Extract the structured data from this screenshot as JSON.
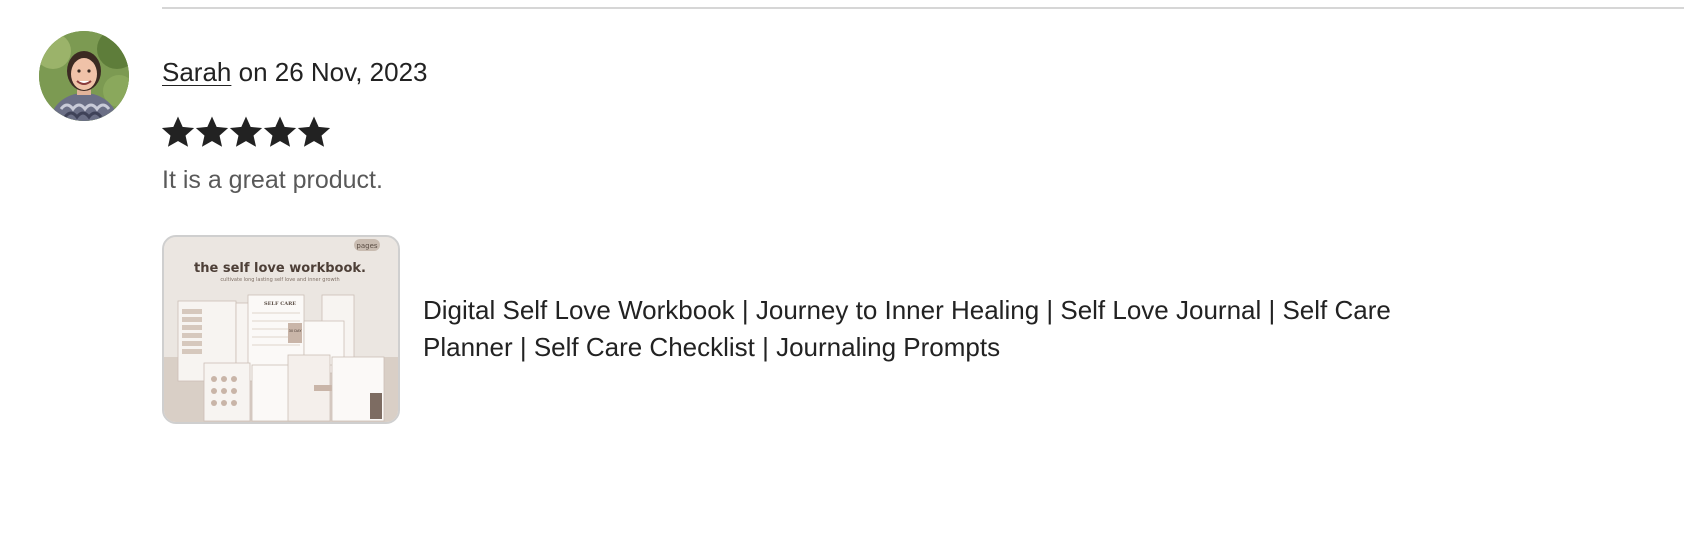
{
  "review": {
    "reviewer_name": "Sarah",
    "date_text": " on 26 Nov, 2023",
    "rating": 5,
    "rating_max": 5,
    "text": "It is a great product."
  },
  "listing": {
    "title": "Digital Self Love Workbook | Journey to Inner Healing | Self Love Journal | Self Care Planner | Self Care Checklist | Journaling Prompts",
    "thumbnail": {
      "heading": "the self love workbook.",
      "subheading": "cultivate long lasting self love and inner growth",
      "badge": "pages",
      "page_labels": [
        "SELF CARE",
        "30 DAY"
      ]
    }
  },
  "colors": {
    "text": "#222222",
    "muted_text": "#595959",
    "star": "#222222",
    "divider": "#d6d6d6",
    "thumb_bg": "#e9e3dd",
    "thumb_accent": "#b9aaa0"
  }
}
